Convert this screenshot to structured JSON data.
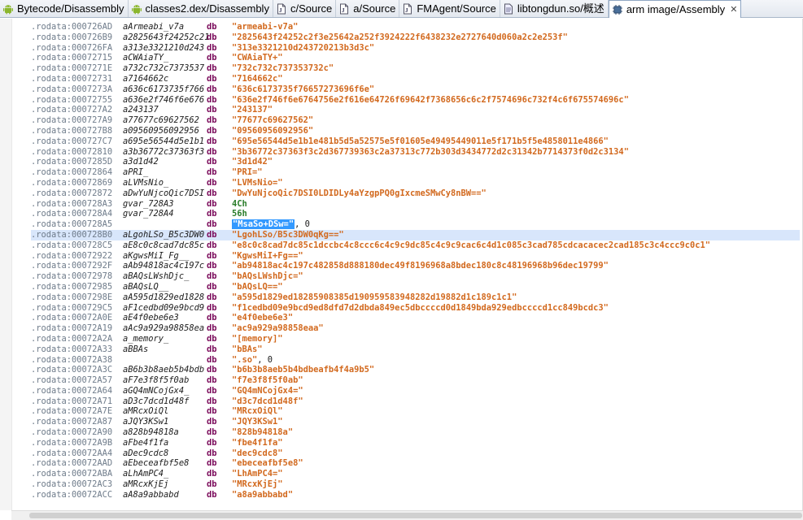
{
  "tabs": [
    {
      "label": "Bytecode/Disassembly",
      "icon": "android-icon",
      "active": false
    },
    {
      "label": "classes2.dex/Disassembly",
      "icon": "android-icon",
      "active": false
    },
    {
      "label": "c/Source",
      "icon": "source-file-icon",
      "active": false
    },
    {
      "label": "a/Source",
      "icon": "source-file-icon",
      "active": false
    },
    {
      "label": "FMAgent/Source",
      "icon": "source-file-icon",
      "active": false
    },
    {
      "label": "libtongdun.so/概述",
      "icon": "binary-file-icon",
      "active": false
    },
    {
      "label": "arm image/Assembly",
      "icon": "chip-icon",
      "active": true
    }
  ],
  "colors": {
    "address": "#6e7b8a",
    "directive": "#7a0a5a",
    "string": "#d2691e",
    "number": "#2a7d2a",
    "highlight": "#d8e6fb",
    "selection": "#3399ff"
  },
  "highlighted_row": 20,
  "rows": [
    {
      "addr": ".rodata:000726AD",
      "name": "aArmeabi_v7a",
      "op": "db",
      "val": "\"armeabi-v7a\""
    },
    {
      "addr": ".rodata:000726B9",
      "name": "a2825643f24252c21",
      "op": "db",
      "val": "\"2825643f24252c2f3e25642a252f3924222f6438232e2727640d060a2c2e253f\""
    },
    {
      "addr": ".rodata:000726FA",
      "name": "a313e3321210d243",
      "op": "db",
      "val": "\"313e3321210d243720213b3d3c\""
    },
    {
      "addr": ".rodata:00072715",
      "name": "aCWAiaTY_",
      "op": "db",
      "val": "\"CWAiaTY+\""
    },
    {
      "addr": ".rodata:0007271E",
      "name": "a732c732c7373537",
      "op": "db",
      "val": "\"732c732c737353732c\""
    },
    {
      "addr": ".rodata:00072731",
      "name": "a7164662c",
      "op": "db",
      "val": "\"7164662c\""
    },
    {
      "addr": ".rodata:0007273A",
      "name": "a636c6173735f766",
      "op": "db",
      "val": "\"636c6173735f76657273696f6e\""
    },
    {
      "addr": ".rodata:00072755",
      "name": "a636e2f746f6e676",
      "op": "db",
      "val": "\"636e2f746f6e6764756e2f616e64726f69642f7368656c6c2f7574696c732f4c6f675574696c\""
    },
    {
      "addr": ".rodata:000727A2",
      "name": "a243137",
      "op": "db",
      "val": "\"243137\""
    },
    {
      "addr": ".rodata:000727A9",
      "name": "a77677c69627562",
      "op": "db",
      "val": "\"77677c69627562\""
    },
    {
      "addr": ".rodata:000727B8",
      "name": "a09560956092956",
      "op": "db",
      "val": "\"09560956092956\""
    },
    {
      "addr": ".rodata:000727C7",
      "name": "a695e56544d5e1b1",
      "op": "db",
      "val": "\"695e56544d5e1b1e481b5d5a52575e5f01605e49495449011e5f171b5f5e4858011e4866\""
    },
    {
      "addr": ".rodata:00072810",
      "name": "a3b36772c37363f3",
      "op": "db",
      "val": "\"3b36772c37363f3c2d367739363c2a37313c772b303d3434772d2c31342b7714373f0d2c3134\""
    },
    {
      "addr": ".rodata:0007285D",
      "name": "a3d1d42",
      "op": "db",
      "val": "\"3d1d42\""
    },
    {
      "addr": ".rodata:00072864",
      "name": "aPRI_",
      "op": "db",
      "val": "\"PRI=\""
    },
    {
      "addr": ".rodata:00072869",
      "name": "aLVMsNio_",
      "op": "db",
      "val": "\"LVMsNio=\""
    },
    {
      "addr": ".rodata:00072872",
      "name": "aDwYuNjcoQic7DSI",
      "op": "db",
      "val": "\"DwYuNjcoQic7DSI0LDIDLy4aYzgpPQ0gIxcmeSMwCy8nBW==\""
    },
    {
      "addr": ".rodata:000728A3",
      "name": "gvar_728A3",
      "op": "db",
      "val": "4Ch",
      "kind": "num"
    },
    {
      "addr": ".rodata:000728A4",
      "name": "gvar_728A4",
      "op": "db",
      "val": "56h",
      "kind": "num"
    },
    {
      "addr": ".rodata:000728A5",
      "name": "",
      "op": "db",
      "val": "\"MsaSo+DSw=\"",
      "rest": ", 0",
      "kind": "selected"
    },
    {
      "addr": ".rodata:000728B0",
      "name": "aLgohLSo_B5c3DW0",
      "op": "db",
      "val": "\"LgohLSo/B5c3DW0qKg==\""
    },
    {
      "addr": ".rodata:000728C5",
      "name": "aE8c0c8cad7dc85c",
      "op": "db",
      "val": "\"e8c0c8cad7dc85c1dccbc4c8ccc6c4c9c9dc85c4c9c9cac6c4d1c085c3cad785cdcacacec2cad185c3c4ccc9c0c1\""
    },
    {
      "addr": ".rodata:00072922",
      "name": "aKgwsMiI_Fg__",
      "op": "db",
      "val": "\"KgwsMiI+Fg==\""
    },
    {
      "addr": ".rodata:0007292F",
      "name": "aAb94818ac4c197c",
      "op": "db",
      "val": "\"ab94818ac4c197c482858d888180dec49f8196968a8bdec180c8c48196968b96dec19799\""
    },
    {
      "addr": ".rodata:00072978",
      "name": "aBAQsLWshDjc_",
      "op": "db",
      "val": "\"bAQsLWshDjc=\""
    },
    {
      "addr": ".rodata:00072985",
      "name": "aBAQsLQ__",
      "op": "db",
      "val": "\"bAQsLQ==\""
    },
    {
      "addr": ".rodata:0007298E",
      "name": "aA595d1829ed1828",
      "op": "db",
      "val": "\"a595d1829ed18285908385d190959583948282d19882d1c189c1c1\""
    },
    {
      "addr": ".rodata:000729C5",
      "name": "aF1cedbd09e9bcd9",
      "op": "db",
      "val": "\"f1cedbd09e9bcd9ed8dfd7d2dbda849ec5dbccccd0d1849bda929edbccccd1cc849bcdc3\""
    },
    {
      "addr": ".rodata:00072A0E",
      "name": "aE4f0ebe6e3",
      "op": "db",
      "val": "\"e4f0ebe6e3\""
    },
    {
      "addr": ".rodata:00072A19",
      "name": "aAc9a929a98858ea",
      "op": "db",
      "val": "\"ac9a929a98858eaa\""
    },
    {
      "addr": ".rodata:00072A2A",
      "name": "a_memory_",
      "op": "db",
      "val": "\"[memory]\""
    },
    {
      "addr": ".rodata:00072A33",
      "name": "aBBAs",
      "op": "db",
      "val": "\"bBAs\""
    },
    {
      "addr": ".rodata:00072A38",
      "name": "",
      "op": "db",
      "val": "\".so\"",
      "rest": ", 0",
      "kind": "plainrest"
    },
    {
      "addr": ".rodata:00072A3C",
      "name": "aB6b3b8aeb5b4bdb",
      "op": "db",
      "val": "\"b6b3b8aeb5b4bdbeafb4f4a9b5\""
    },
    {
      "addr": ".rodata:00072A57",
      "name": "aF7e3f8f5f0ab",
      "op": "db",
      "val": "\"f7e3f8f5f0ab\""
    },
    {
      "addr": ".rodata:00072A64",
      "name": "aGQ4mNCojGx4_",
      "op": "db",
      "val": "\"GQ4mNCojGx4=\""
    },
    {
      "addr": ".rodata:00072A71",
      "name": "aD3c7dcd1d48f",
      "op": "db",
      "val": "\"d3c7dcd1d48f\""
    },
    {
      "addr": ".rodata:00072A7E",
      "name": "aMRcxOiQl",
      "op": "db",
      "val": "\"MRcxOiQl\""
    },
    {
      "addr": ".rodata:00072A87",
      "name": "aJQY3KSw1",
      "op": "db",
      "val": "\"JQY3KSw1\""
    },
    {
      "addr": ".rodata:00072A90",
      "name": "a828b94818a",
      "op": "db",
      "val": "\"828b94818a\""
    },
    {
      "addr": ".rodata:00072A9B",
      "name": "aFbe4f1fa",
      "op": "db",
      "val": "\"fbe4f1fa\""
    },
    {
      "addr": ".rodata:00072AA4",
      "name": "aDec9cdc8",
      "op": "db",
      "val": "\"dec9cdc8\""
    },
    {
      "addr": ".rodata:00072AAD",
      "name": "aEbeceafbf5e8",
      "op": "db",
      "val": "\"ebeceafbf5e8\""
    },
    {
      "addr": ".rodata:00072ABA",
      "name": "aLhAmPC4_",
      "op": "db",
      "val": "\"LhAmPC4=\""
    },
    {
      "addr": ".rodata:00072AC3",
      "name": "aMRcxKjEj",
      "op": "db",
      "val": "\"MRcxKjEj\""
    },
    {
      "addr": ".rodata:00072ACC",
      "name": "aA8a9abbabd",
      "op": "db",
      "val": "\"a8a9abbabd\""
    }
  ]
}
